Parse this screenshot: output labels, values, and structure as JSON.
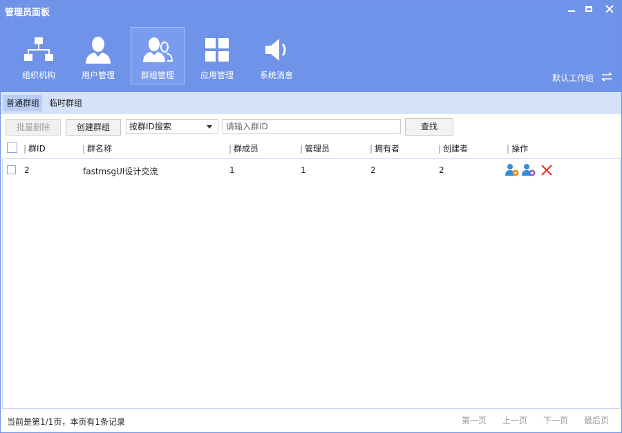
{
  "window": {
    "title": "管理员面板"
  },
  "nav": {
    "items": [
      {
        "label": "组织机构",
        "icon": "org-chart-icon"
      },
      {
        "label": "用户管理",
        "icon": "user-icon"
      },
      {
        "label": "群组管理",
        "icon": "group-icon",
        "active": true
      },
      {
        "label": "应用管理",
        "icon": "apps-grid-icon"
      },
      {
        "label": "系统消息",
        "icon": "speaker-icon"
      }
    ],
    "workgroup_label": "默认工作组"
  },
  "subtabs": [
    {
      "label": "普通群组",
      "active": true
    },
    {
      "label": "临时群组",
      "active": false
    }
  ],
  "toolbar": {
    "batch_delete_label": "批量删除",
    "create_group_label": "创建群组",
    "search_mode": "按群ID搜索",
    "search_placeholder": "请输入群ID",
    "find_label": "查找"
  },
  "table": {
    "columns": [
      "群ID",
      "群名称",
      "群成员",
      "管理员",
      "拥有者",
      "创建者",
      "操作"
    ],
    "rows": [
      {
        "id": "2",
        "name": "fastmsgUI设计交流",
        "members": "1",
        "admins": "1",
        "owner": "2",
        "creator": "2"
      }
    ]
  },
  "footer": {
    "status": "当前是第1/1页，本页有1条记录",
    "first": "第一页",
    "prev": "上一页",
    "next": "下一页",
    "last": "最后页"
  },
  "colors": {
    "header": "#6f93e8",
    "subtab_bar": "#d6e2fa",
    "accent": "#2f8fd8",
    "delete": "#e0322c"
  }
}
